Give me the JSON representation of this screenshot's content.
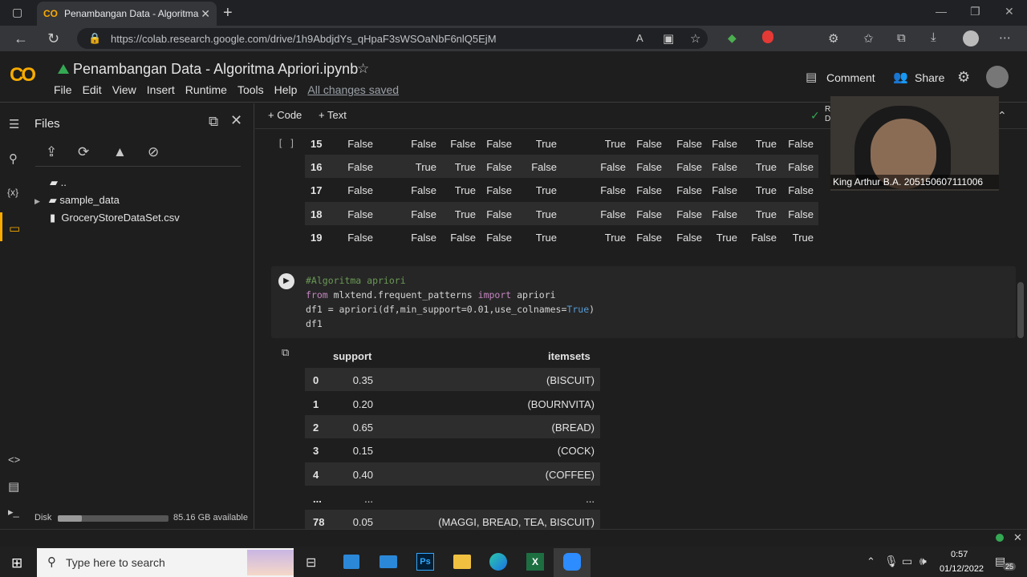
{
  "browser": {
    "tab_title": "Penambangan Data - Algoritma",
    "tab_logo": "CO",
    "url": "https://colab.research.google.com/drive/1h9AbdjdYs_qHpaF3sWSOaNbF6nlQ5EjM"
  },
  "colab": {
    "logo": "CO",
    "notebook_title": "Penambangan Data - Algoritma Apriori.ipynb",
    "menus": [
      "File",
      "Edit",
      "View",
      "Insert",
      "Runtime",
      "Tools",
      "Help"
    ],
    "save_status": "All changes saved",
    "comment_label": "Comment",
    "share_label": "Share",
    "toolbar_code": "+ Code",
    "toolbar_text": "+ Text",
    "right_clip": "R D"
  },
  "files_panel": {
    "title": "Files",
    "items": [
      "..",
      "sample_data",
      "GroceryStoreDataSet.csv"
    ],
    "disk_label": "Disk",
    "disk_available": "85.16 GB available",
    "disk_used_fraction": 0.22
  },
  "bool_table": {
    "prompt": "[ ]",
    "rows": [
      {
        "idx": "15",
        "vals": [
          "False",
          "False",
          "False",
          "False",
          "True",
          "True",
          "False",
          "False",
          "False",
          "True",
          "False"
        ]
      },
      {
        "idx": "16",
        "vals": [
          "False",
          "True",
          "True",
          "False",
          "False",
          "False",
          "False",
          "False",
          "False",
          "True",
          "False"
        ]
      },
      {
        "idx": "17",
        "vals": [
          "False",
          "False",
          "True",
          "False",
          "True",
          "False",
          "False",
          "False",
          "False",
          "True",
          "False"
        ]
      },
      {
        "idx": "18",
        "vals": [
          "False",
          "False",
          "True",
          "False",
          "True",
          "False",
          "False",
          "False",
          "False",
          "True",
          "False"
        ]
      },
      {
        "idx": "19",
        "vals": [
          "False",
          "False",
          "False",
          "False",
          "True",
          "True",
          "False",
          "False",
          "True",
          "False",
          "True"
        ]
      }
    ]
  },
  "code_cell": {
    "line1": "#Algoritma apriori",
    "line2_kw1": "from",
    "line2_mid": " mlxtend.frequent_patterns ",
    "line2_kw2": "import",
    "line2_end": " apriori",
    "line3_a": "df1 = apriori(df,min_support=0.01,use_colnames=",
    "line3_true": "True",
    "line3_b": ")",
    "line4": "df1"
  },
  "output_table": {
    "headers": [
      "support",
      "itemsets"
    ],
    "rows": [
      {
        "idx": "0",
        "support": "0.35",
        "itemsets": "(BISCUIT)"
      },
      {
        "idx": "1",
        "support": "0.20",
        "itemsets": "(BOURNVITA)"
      },
      {
        "idx": "2",
        "support": "0.65",
        "itemsets": "(BREAD)"
      },
      {
        "idx": "3",
        "support": "0.15",
        "itemsets": "(COCK)"
      },
      {
        "idx": "4",
        "support": "0.40",
        "itemsets": "(COFFEE)"
      },
      {
        "idx": "...",
        "support": "...",
        "itemsets": "..."
      },
      {
        "idx": "78",
        "support": "0.05",
        "itemsets": "(MAGGI, BREAD, TEA, BISCUIT)"
      }
    ]
  },
  "webcam": {
    "caption": "King Arthur B.A. 205150607111006"
  },
  "taskbar": {
    "search_placeholder": "Type here to search",
    "time": "0:57",
    "date": "01/12/2022",
    "notif_count": "25"
  }
}
